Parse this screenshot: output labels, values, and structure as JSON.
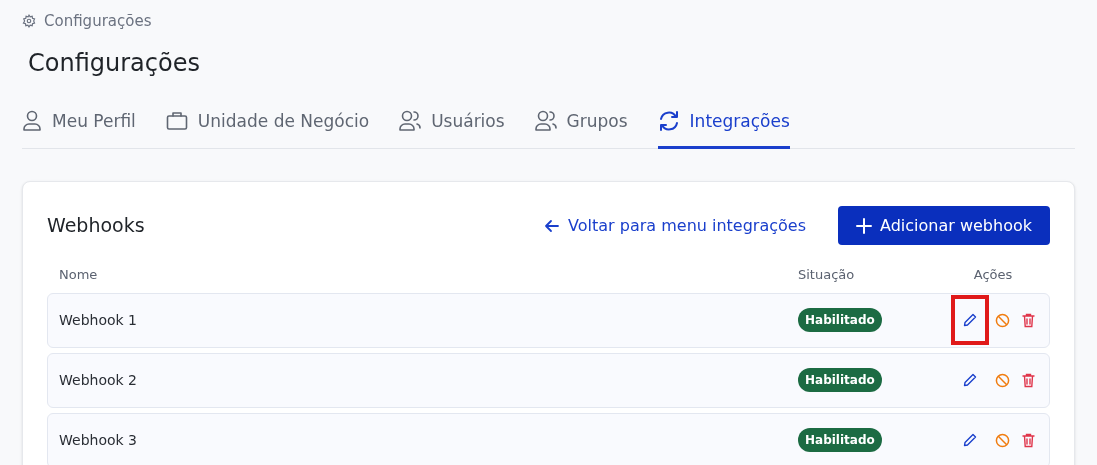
{
  "breadcrumb": "Configurações",
  "title": "Configurações",
  "tabs": [
    {
      "label": "Meu Perfil",
      "selected": false
    },
    {
      "label": "Unidade de Negócio",
      "selected": false
    },
    {
      "label": "Usuários",
      "selected": false
    },
    {
      "label": "Grupos",
      "selected": false
    },
    {
      "label": "Integrações",
      "selected": true
    }
  ],
  "card": {
    "title": "Webhooks",
    "back_link": "Voltar para menu integrações",
    "add_button": "Adicionar webhook",
    "table": {
      "columns": [
        "Nome",
        "Situação",
        "Ações"
      ],
      "rows": [
        {
          "name": "Webhook 1",
          "status": "Habilitado",
          "edit_highlighted": true
        },
        {
          "name": "Webhook 2",
          "status": "Habilitado",
          "edit_highlighted": false
        },
        {
          "name": "Webhook 3",
          "status": "Habilitado",
          "edit_highlighted": false
        }
      ]
    }
  }
}
